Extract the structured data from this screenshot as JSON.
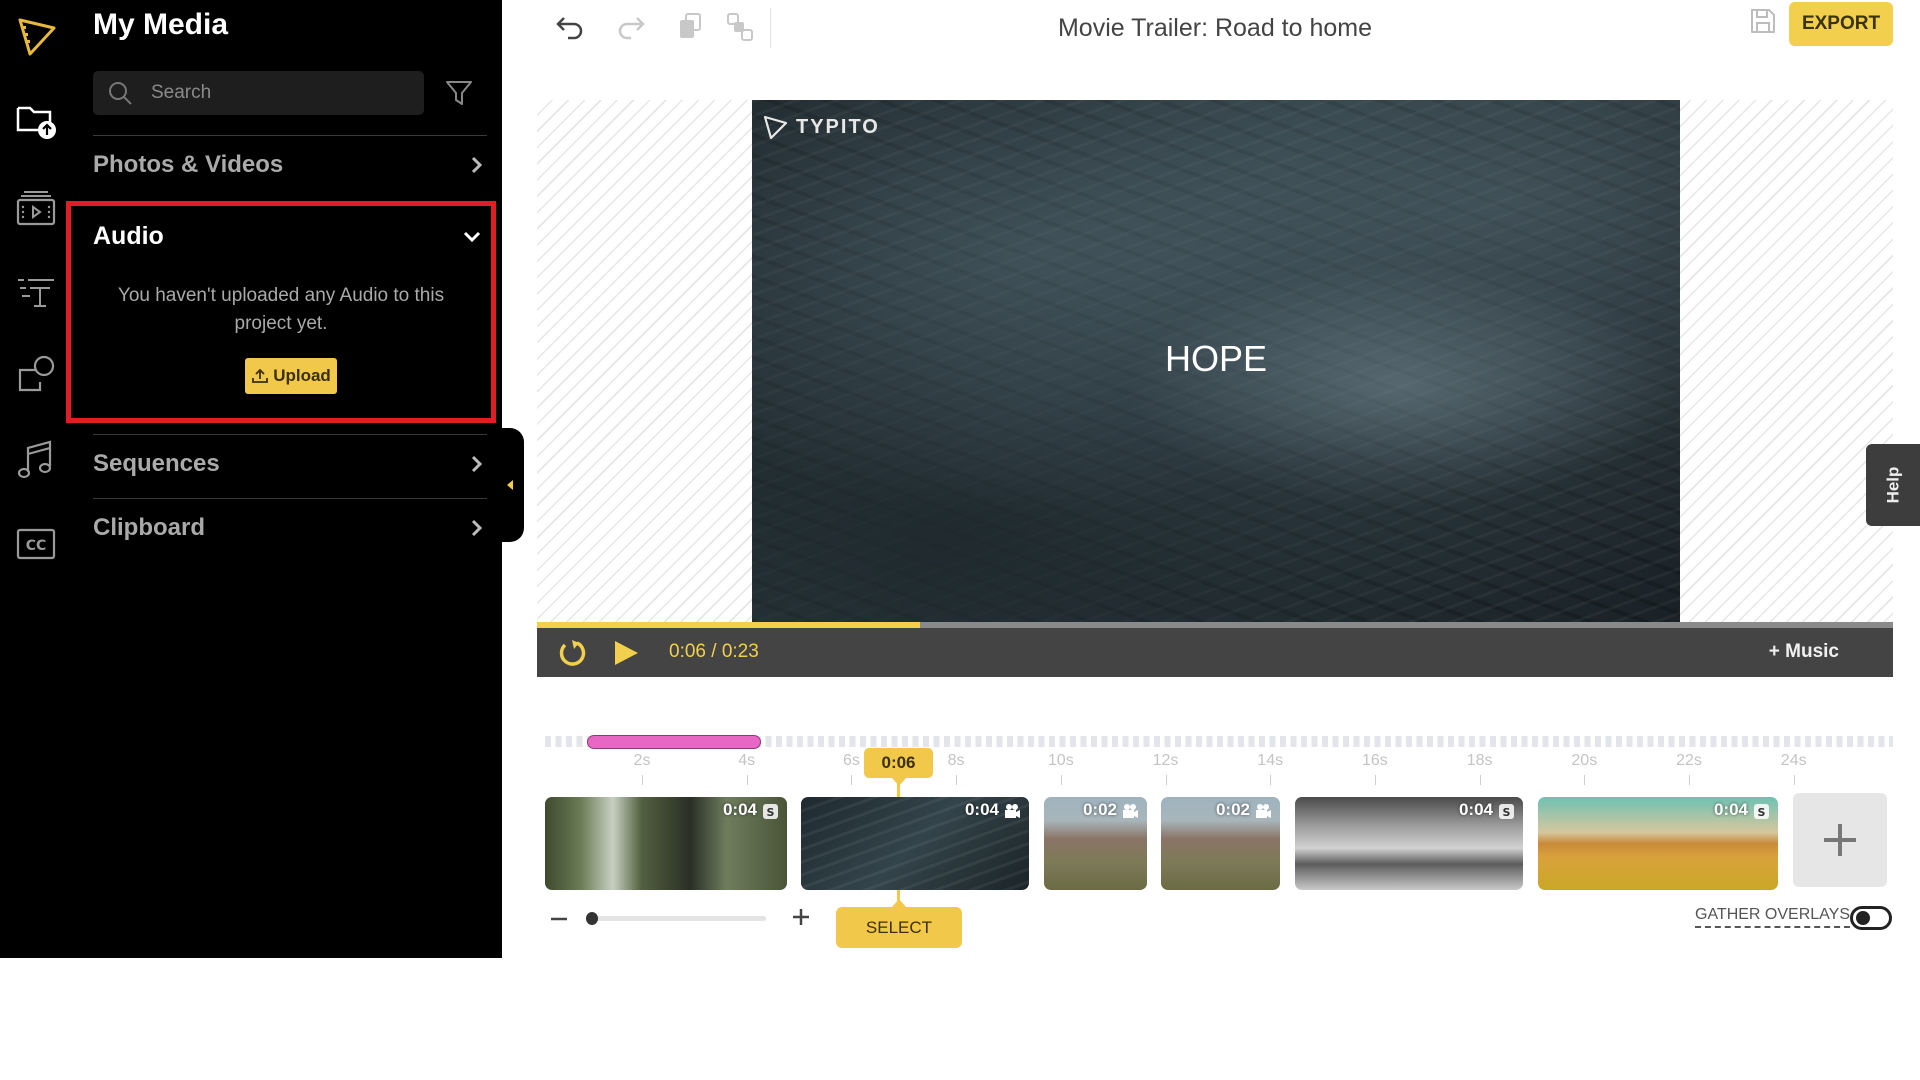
{
  "sidebar": {
    "title": "My Media",
    "search": {
      "placeholder": "Search",
      "value": ""
    },
    "rail_icons": [
      "logo-icon",
      "media-upload-icon",
      "videos-icon",
      "text-icon",
      "shapes-icon",
      "music-icon",
      "captions-icon"
    ],
    "sections": [
      {
        "label": "Photos & Videos",
        "expanded": false
      },
      {
        "label": "Audio",
        "expanded": true,
        "empty_message": "You haven't uploaded any Audio to this project yet.",
        "upload_label": "Upload"
      },
      {
        "label": "Sequences",
        "expanded": false
      },
      {
        "label": "Clipboard",
        "expanded": false
      }
    ]
  },
  "toolbar": {
    "project_title": "Movie Trailer: Road to home",
    "export_label": "EXPORT"
  },
  "preview": {
    "watermark": "TYPITO",
    "overlay_text": "HOPE",
    "current_time": "0:06",
    "total_time": "0:23",
    "time_separator": "/",
    "progress": 0.2826,
    "add_music_label": "+ Music",
    "help_label": "Help"
  },
  "timeline": {
    "playhead_label": "0:06",
    "ticks": [
      "2s",
      "4s",
      "6s",
      "8s",
      "10s",
      "12s",
      "14s",
      "16s",
      "18s",
      "20s",
      "22s",
      "24s"
    ],
    "clips": [
      {
        "duration": "0:04",
        "type": "sequence",
        "scene": "forest"
      },
      {
        "duration": "0:04",
        "type": "video",
        "scene": "ocean"
      },
      {
        "duration": "0:02",
        "type": "video",
        "scene": "mountain"
      },
      {
        "duration": "0:02",
        "type": "video",
        "scene": "mountain"
      },
      {
        "duration": "0:04",
        "type": "sequence",
        "scene": "grayscale"
      },
      {
        "duration": "0:04",
        "type": "sequence",
        "scene": "field"
      }
    ],
    "select_label": "SELECT",
    "gather_overlays_label": "GATHER OVERLAYS",
    "gather_overlays_on": false
  },
  "colors": {
    "accent": "#f2cf4c",
    "highlight_box": "#e11d25",
    "audio_track": "#e967c4",
    "control_bar": "#444444"
  }
}
